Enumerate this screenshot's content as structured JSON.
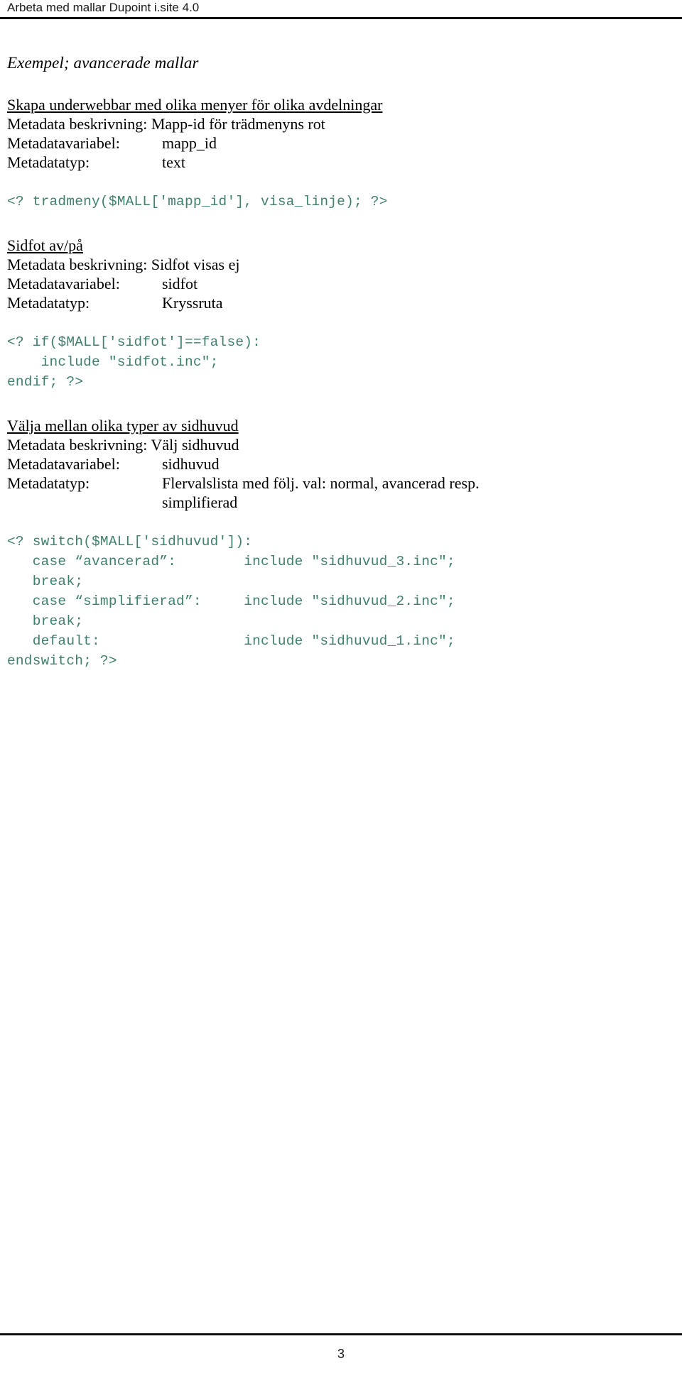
{
  "header": {
    "running_title": "Arbeta med mallar Dupoint i.site 4.0"
  },
  "document": {
    "section_title": "Exempel; avancerade mallar",
    "labels": {
      "variable": "Metadatavariabel:",
      "type": "Metadatatyp:"
    },
    "sections": [
      {
        "heading": "Skapa underwebbar med olika menyer för olika avdelningar",
        "description": "Metadata beskrivning: Mapp-id för trädmenyns rot",
        "variable_label": "Metadatavariabel:",
        "variable_value": "mapp_id",
        "type_label": "Metadatatyp:",
        "type_value": "text",
        "type_value_cont": "",
        "code": "<? tradmeny($MALL['mapp_id'], visa_linje); ?>"
      },
      {
        "heading": "Sidfot av/på",
        "description": "Metadata beskrivning: Sidfot visas ej",
        "variable_label": "Metadatavariabel:",
        "variable_value": "sidfot",
        "type_label": "Metadatatyp:",
        "type_value": "Kryssruta",
        "type_value_cont": "",
        "code": "<? if($MALL['sidfot']==false):\n    include \"sidfot.inc\";\nendif; ?>"
      },
      {
        "heading": "Välja mellan olika typer av sidhuvud",
        "description": "Metadata beskrivning: Välj sidhuvud",
        "variable_label": "Metadatavariabel:",
        "variable_value": "sidhuvud",
        "type_label": "Metadatatyp:",
        "type_value": "Flervalslista med följ. val: normal, avancerad resp.",
        "type_value_cont": "simplifierad",
        "code": "<? switch($MALL['sidhuvud']):\n   case “avancerad”:        include \"sidhuvud_3.inc\";\n   break;\n   case “simplifierad”:     include \"sidhuvud_2.inc\";\n   break;\n   default:                 include \"sidhuvud_1.inc\";\nendswitch; ?>"
      }
    ]
  },
  "footer": {
    "page_number": "3"
  },
  "colors": {
    "code_text": "#3f7f6d",
    "body_text": "#000000",
    "rule": "#0f0f0f"
  }
}
